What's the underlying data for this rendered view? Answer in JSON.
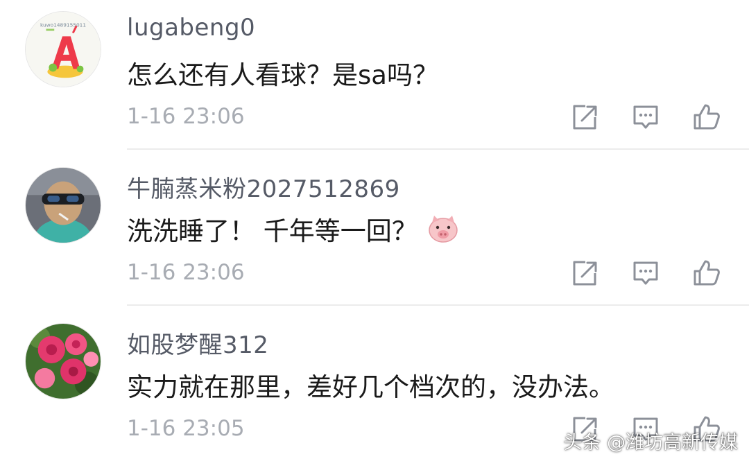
{
  "comments": [
    {
      "username": "lugabeng0",
      "content": "怎么还有人看球？是sa吗？",
      "time": "1-16 23:06",
      "avatar_icon": "letter-a-cartoon-avatar"
    },
    {
      "username": "牛腩蒸米粉2027512869",
      "content": "洗洗睡了！ 千年等一回？",
      "time": "1-16 23:06",
      "avatar_icon": "child-sunglasses-photo-avatar",
      "emoji_icon": "pig-face-emoji"
    },
    {
      "username": "如股梦醒312",
      "content": "实力就在那里，差好几个档次的，没办法。",
      "time": "1-16 23:05",
      "avatar_icon": "pink-flowers-photo-avatar"
    }
  ],
  "avatar_caption": "kuwo1489155011",
  "watermark": "头条 @潍坊高新传媒",
  "colors": {
    "username": "#555a66",
    "content": "#1a1a1a",
    "time": "#a8acb3",
    "icon": "#8c9099",
    "divider": "#ececec"
  }
}
